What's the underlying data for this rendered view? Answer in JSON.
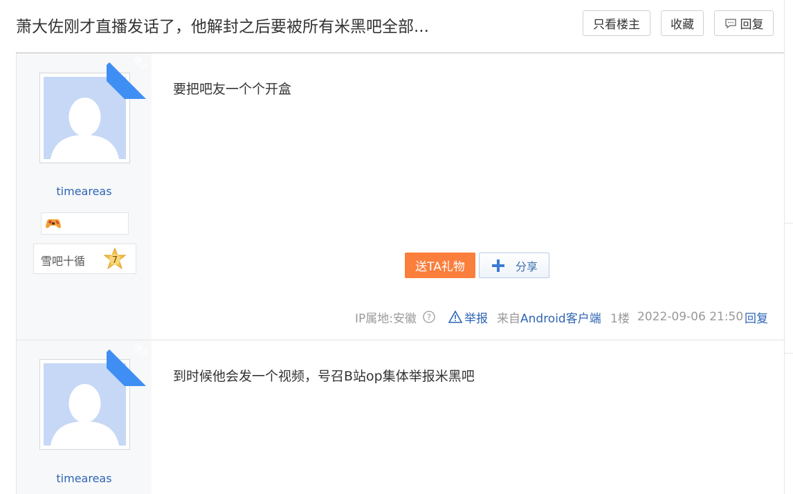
{
  "thread": {
    "title": "萧大佐刚才直播发话了，他解封之后要被所有米黑吧全部..."
  },
  "header_buttons": {
    "only_op": "只看楼主",
    "favorite": "收藏",
    "reply": "回复"
  },
  "posts": [
    {
      "corner_tag": "楼主",
      "username": "timeareas",
      "level_name": "雪吧十循",
      "level_number": "7",
      "content": "要把吧友一个个开盒",
      "gift_button": "送TA礼物",
      "share_button": "分享",
      "ip_location": "IP属地:安徽",
      "report": "举报",
      "source_prefix": "来自",
      "source_client": "Android客户端",
      "floor": "1楼",
      "date": "2022-09-06 21:50",
      "reply": "回复"
    },
    {
      "corner_tag": "楼主",
      "username": "timeareas",
      "content": "到时候他会发一个视频，号召B站op集体举报米黑吧"
    }
  ],
  "colors": {
    "link_blue": "#2d64b3",
    "corner_blue": "#3f8ef3",
    "gift_orange": "#fa7e3c",
    "avatar_bg": "#c6d8f5"
  }
}
